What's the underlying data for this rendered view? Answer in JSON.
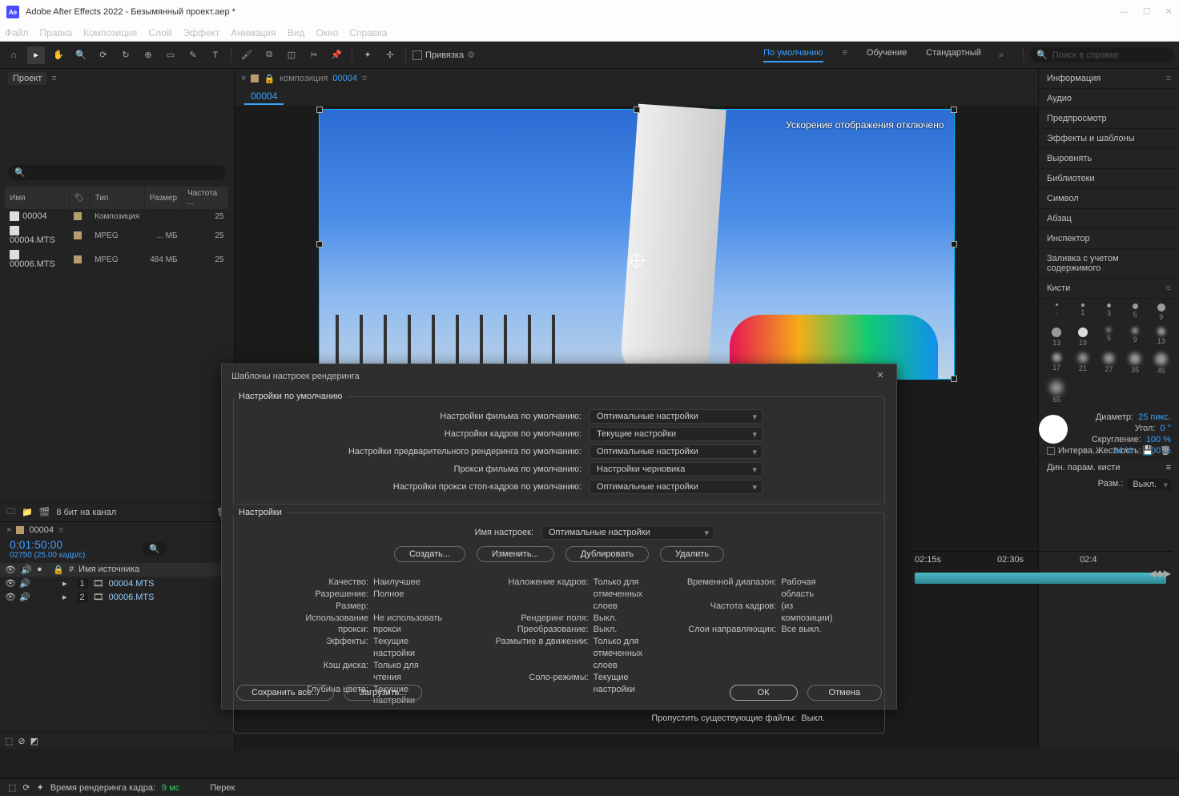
{
  "titlebar": {
    "app": "Adobe After Effects 2022 - Безымянный проект.aep *"
  },
  "menu": [
    "Файл",
    "Правка",
    "Композиция",
    "Слой",
    "Эффект",
    "Анимация",
    "Вид",
    "Окно",
    "Справка"
  ],
  "toolbar": {
    "snap_label": "Привязка",
    "workspaces": [
      "По умолчанию",
      "Обучение",
      "Стандартный"
    ],
    "search_placeholder": "Поиск в справке"
  },
  "project": {
    "tab": "Проект",
    "headers": {
      "name": "Имя",
      "type": "Тип",
      "size": "Размер",
      "fps": "Частота ..."
    },
    "rows": [
      {
        "name": "00004",
        "type": "Композиция",
        "size": "",
        "fps": "25"
      },
      {
        "name": "00004.MTS",
        "type": "MPEG",
        "size": "... МБ",
        "fps": "25"
      },
      {
        "name": "00006.MTS",
        "type": "MPEG",
        "size": "484 МБ",
        "fps": "25"
      }
    ],
    "footer_bits": "8 бит на канал"
  },
  "comp": {
    "prefix": "композиция",
    "name": "00004",
    "overlay": "Ускорение отображения отключено"
  },
  "right_panels": [
    "Информация",
    "Аудио",
    "Предпросмотр",
    "Эффекты и шаблоны",
    "Выровнять",
    "Библиотеки",
    "Символ",
    "Абзац",
    "Инспектор",
    "Заливка с учетом содержимого"
  ],
  "brushes": {
    "title": "Кисти",
    "items": [
      ".",
      "1",
      "3",
      "5",
      "9",
      "13",
      "19",
      "5",
      "9",
      "13",
      "17",
      "21",
      "27",
      "35",
      "45",
      "65"
    ],
    "diam_label": "Диаметр:",
    "diam_val": "25 пикс.",
    "angle_label": "Угол:",
    "angle_val": "0 °",
    "round_label": "Скругление:",
    "round_val": "100 %",
    "hard_label": "Жесткость:",
    "hard_val": "100 %",
    "interval_label": "Интерва...",
    "interval_val": "24 %",
    "dyn_title": "Дин. парам. кисти",
    "size_label": "Разм.:",
    "size_val": "Выкл."
  },
  "timeline": {
    "tab": "00004",
    "timecode": "0:01:50:00",
    "sub": "02750 (25.00 кадр/с)",
    "col_num": "#",
    "col_src": "Имя источника",
    "rows": [
      {
        "num": "1",
        "src": "00004.MTS"
      },
      {
        "num": "2",
        "src": "00006.MTS"
      }
    ],
    "ruler": [
      "02:15s",
      "02:30s",
      "02:4"
    ]
  },
  "status": {
    "label": "Время рендеринга кадра:",
    "val": "9 мс",
    "extra": "Перек"
  },
  "modal": {
    "title": "Шаблоны настроек рендеринга",
    "defaults_legend": "Настройки по умолчанию",
    "def_rows": [
      {
        "label": "Настройки фильма по умолчанию:",
        "value": "Оптимальные настройки"
      },
      {
        "label": "Настройки кадров по умолчанию:",
        "value": "Текущие настройки"
      },
      {
        "label": "Настройки предварительного рендеринга по умолчанию:",
        "value": "Оптимальные настройки"
      },
      {
        "label": "Прокси фильма по умолчанию:",
        "value": "Настройки черновика"
      },
      {
        "label": "Настройки прокси стоп-кадров по умолчанию:",
        "value": "Оптимальные настройки"
      }
    ],
    "settings_legend": "Настройки",
    "name_label": "Имя настроек:",
    "name_value": "Оптимальные настройки",
    "btn_create": "Создать...",
    "btn_edit": "Изменить...",
    "btn_dup": "Дублировать",
    "btn_del": "Удалить",
    "details": {
      "col1": [
        [
          "Качество:",
          "Наилучшее"
        ],
        [
          "Разрешение:",
          "Полное"
        ],
        [
          "Размер:",
          ""
        ],
        [
          "Использование прокси:",
          "Не использовать прокси"
        ],
        [
          "Эффекты:",
          "Текущие  настройки"
        ],
        [
          "Кэш диска:",
          "Только для чтения"
        ],
        [
          "Глубина цвета:",
          "Текущие настройки"
        ]
      ],
      "col2": [
        [
          "Наложение кадров:",
          "Только для отмеченных слоев"
        ],
        [
          "Рендеринг поля:",
          "Выкл."
        ],
        [
          "Преобразование:",
          "Выкл."
        ],
        [
          "Размытие в движении:",
          "Только для отмеченных слоев"
        ],
        [
          "",
          ""
        ],
        [
          "Соло-режимы:",
          "Текущие  настройки"
        ]
      ],
      "col3": [
        [
          "Временной диапазон:",
          "Рабочая область"
        ],
        [
          "",
          ""
        ],
        [
          "",
          ""
        ],
        [
          "Частота кадров:",
          "(из композиции)"
        ],
        [
          "Слои направляющих:",
          "Все выкл."
        ]
      ]
    },
    "skip_label": "Пропустить существующие файлы:",
    "skip_val": "Выкл.",
    "save_all": "Сохранить все...",
    "load": "Загрузить...",
    "ok": "ОК",
    "cancel": "Отмена"
  }
}
